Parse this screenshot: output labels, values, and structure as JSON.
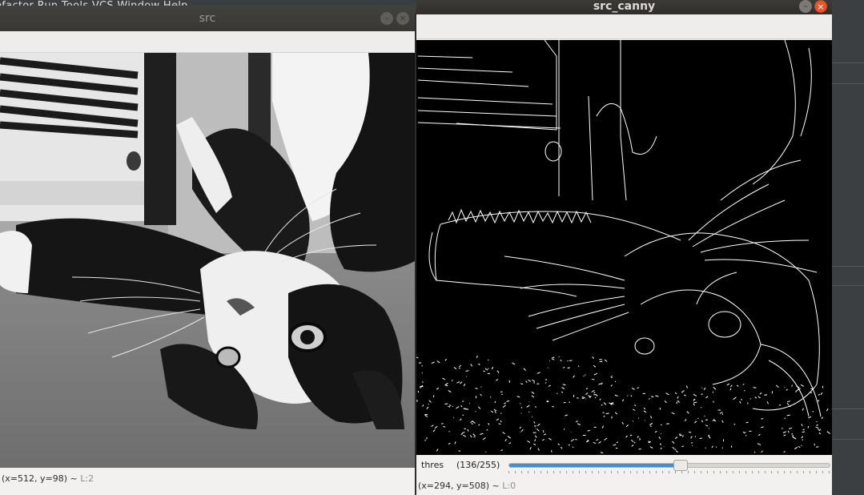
{
  "ide": {
    "menubar_text": "efactor  Run  Tools  VCS  Window  Help"
  },
  "src_window": {
    "title": "src",
    "status_text": "(x=512, y=98) ~ ",
    "status_level": "L:2"
  },
  "canny_window": {
    "title": "src_canny",
    "status_text": "(x=294, y=508) ~ ",
    "status_level": "L:0"
  },
  "trackbar": {
    "label": "thres",
    "value_text": "(136/255)",
    "value": 136,
    "max": 255
  },
  "controls": {
    "minimize": "–",
    "close": "×"
  },
  "colors": {
    "titlebar": "#3c3b37",
    "close_button": "#e3582a",
    "trackbar_fill": "#3d8fd1",
    "edge_lines": "#ffffff"
  }
}
